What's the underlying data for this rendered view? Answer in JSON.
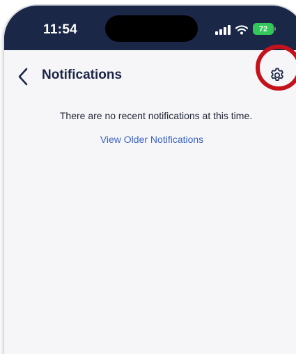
{
  "status_bar": {
    "time": "11:54",
    "battery": "72",
    "icons": [
      "signal-icon",
      "wifi-icon",
      "battery-icon"
    ]
  },
  "header": {
    "title": "Notifications",
    "back_icon": "chevron-left-icon",
    "settings_icon": "gear-icon"
  },
  "content": {
    "empty_message": "There are no recent notifications at this time.",
    "older_link": "View Older Notifications"
  },
  "colors": {
    "status_bar_bg": "#1a2747",
    "screen_bg": "#f6f6f9",
    "title": "#1b2544",
    "link": "#3b63c4",
    "highlight": "#c4121b",
    "battery": "#34c759"
  }
}
